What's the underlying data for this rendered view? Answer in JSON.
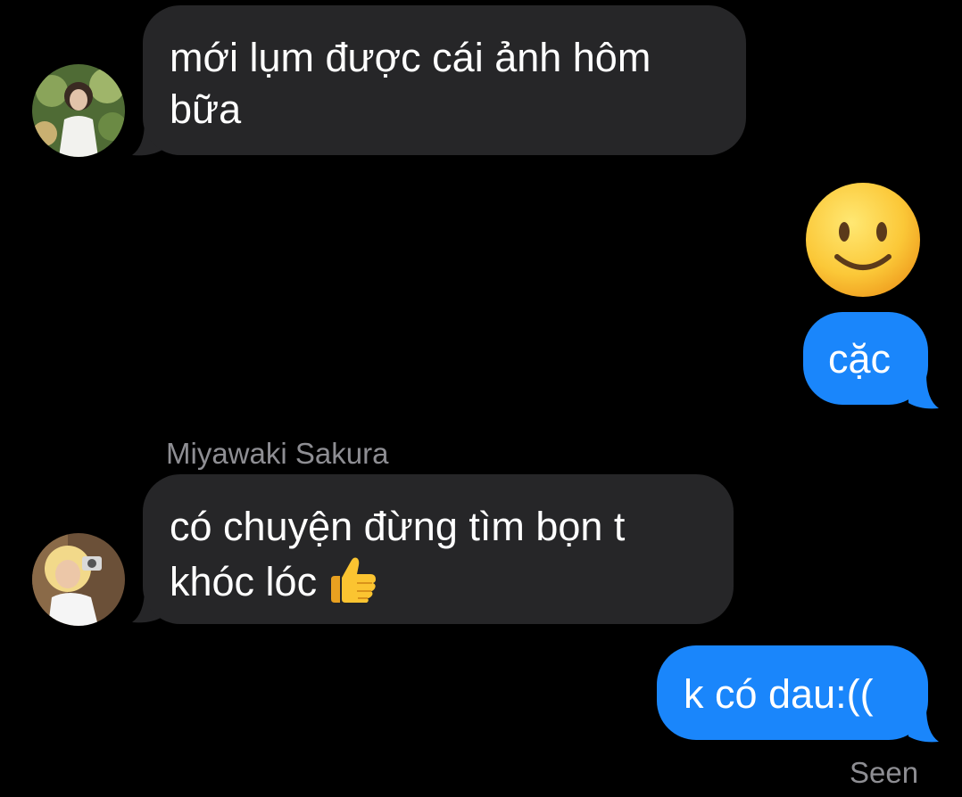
{
  "thread": {
    "messages": [
      {
        "sender_label": "",
        "text": "mới lụm được cái ảnh hôm bữa",
        "direction": "incoming"
      },
      {
        "emoji": "slightly-smiling-face-icon",
        "direction": "outgoing"
      },
      {
        "text": "cặc",
        "direction": "outgoing"
      },
      {
        "sender_label": "Miyawaki Sakura",
        "text": "có chuyện đừng tìm bọn t khóc lóc",
        "emoji": "thumbs-up-icon",
        "direction": "incoming"
      },
      {
        "text": "k có dau:((",
        "direction": "outgoing"
      }
    ],
    "status": "Seen"
  },
  "colors": {
    "background": "#000000",
    "incoming_bubble": "#262628",
    "outgoing_bubble": "#1a86fb",
    "meta_text": "#8e8e93"
  }
}
